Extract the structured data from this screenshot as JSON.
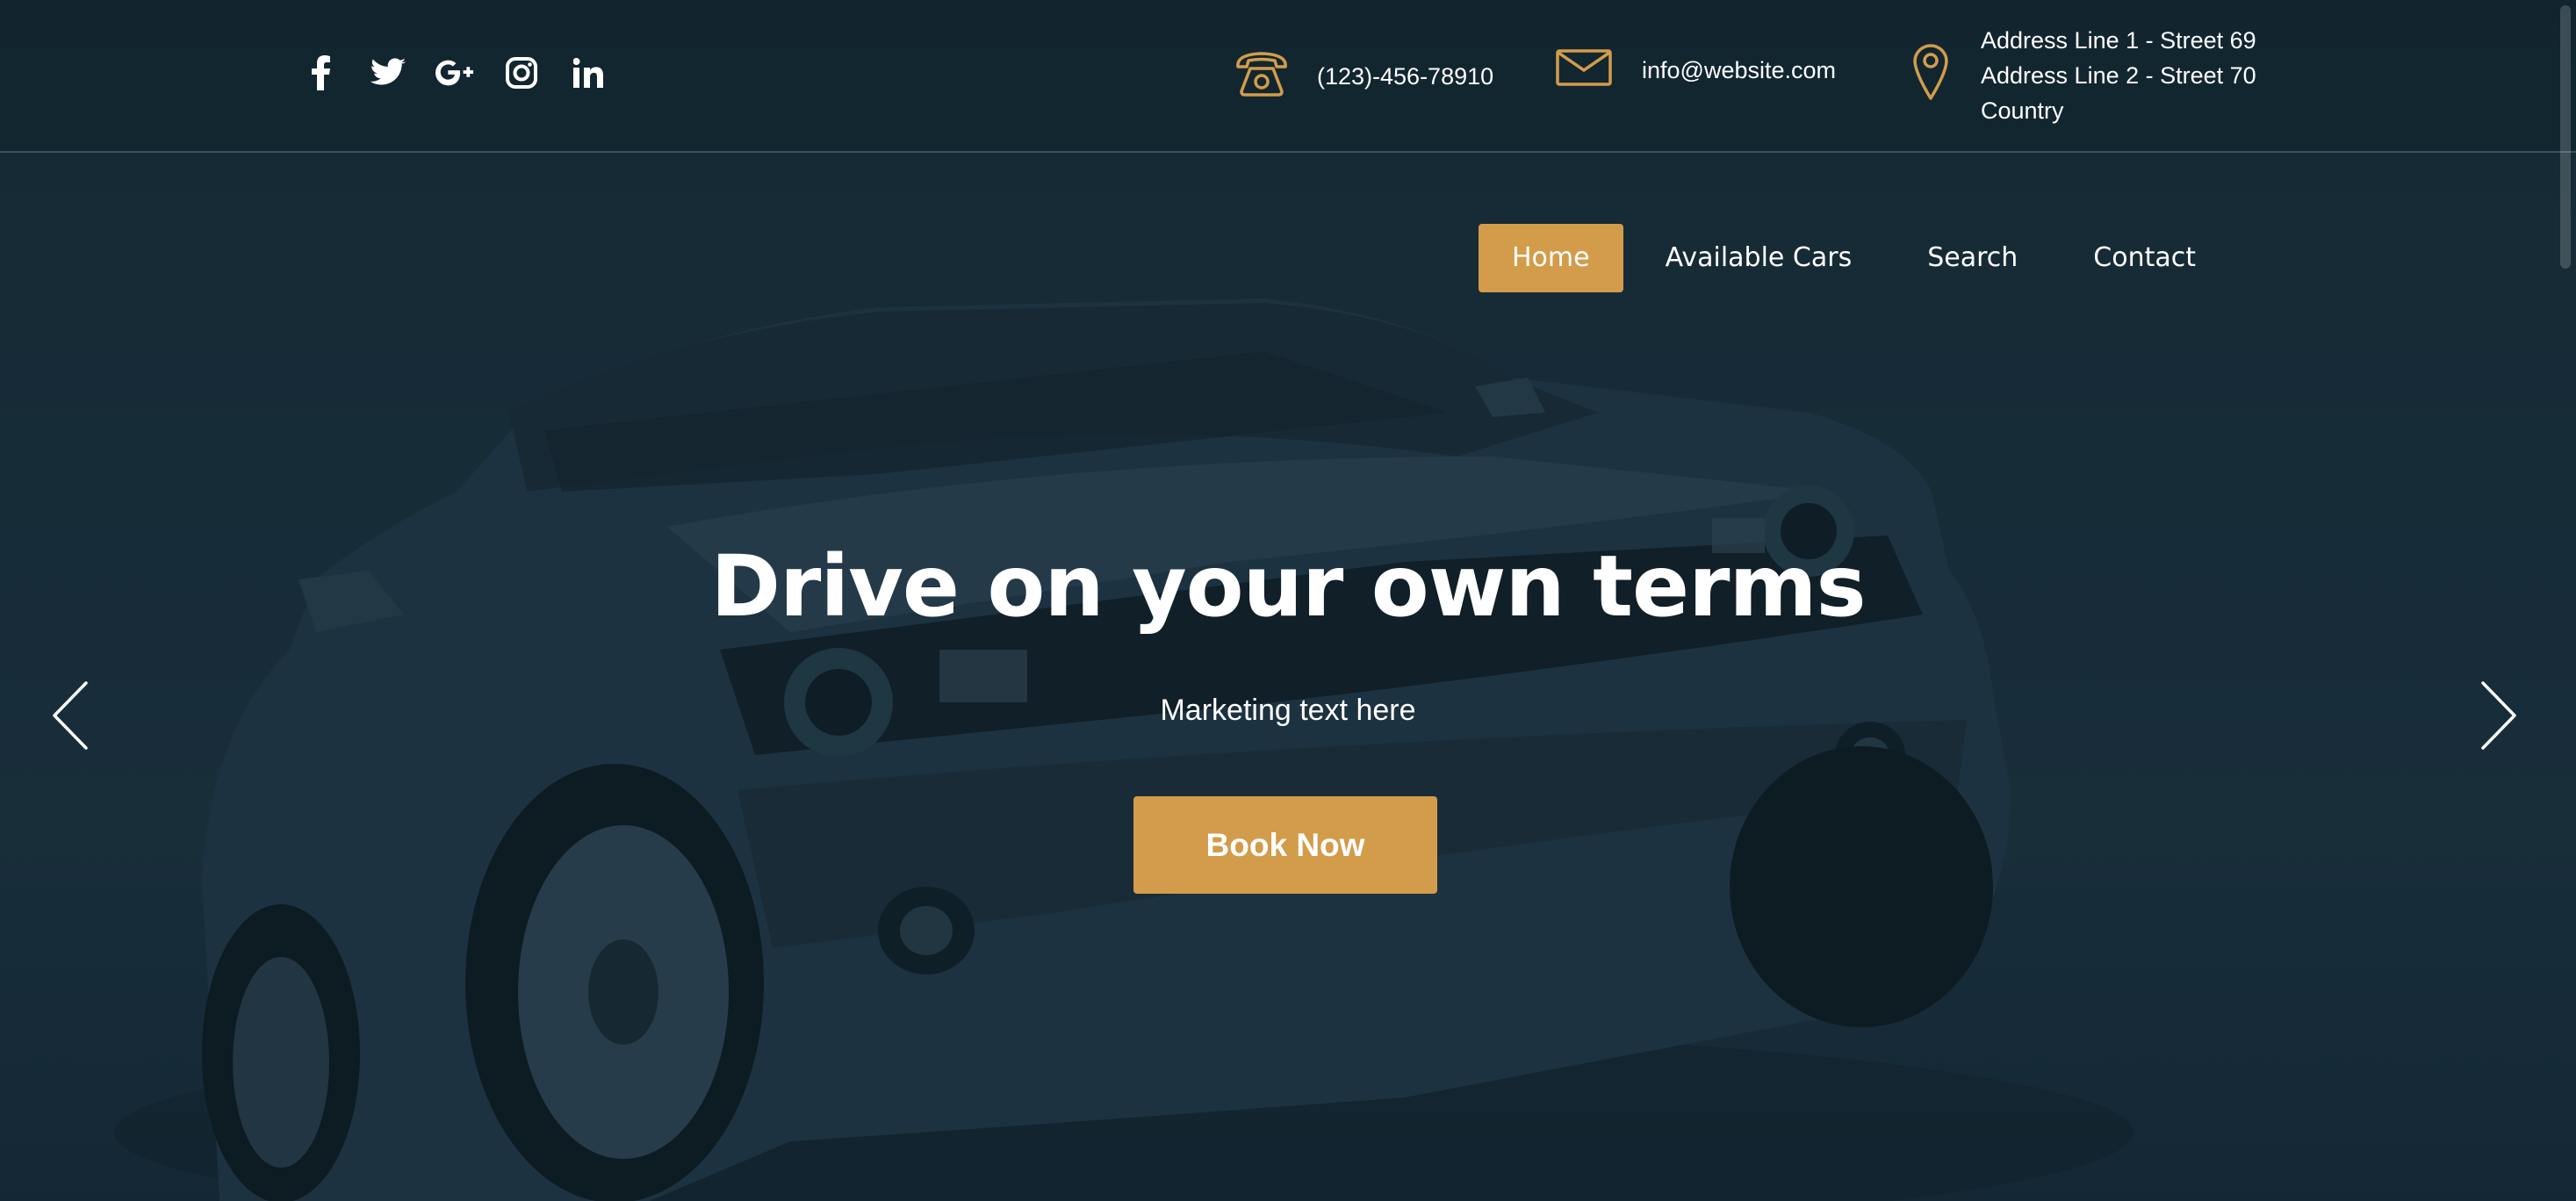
{
  "colors": {
    "accent": "#d39c4b",
    "background": "#132630",
    "text": "#ffffff"
  },
  "topbar": {
    "social": [
      {
        "name": "facebook-icon"
      },
      {
        "name": "twitter-icon"
      },
      {
        "name": "google-plus-icon"
      },
      {
        "name": "instagram-icon"
      },
      {
        "name": "linkedin-icon"
      }
    ],
    "phone": {
      "icon": "phone-icon",
      "text": "(123)-456-78910"
    },
    "email": {
      "icon": "envelope-icon",
      "text": "info@website.com"
    },
    "address": {
      "icon": "map-pin-icon",
      "lines": [
        "Address Line 1 - Street 69",
        "Address Line 2 - Street 70",
        "Country"
      ]
    }
  },
  "nav": {
    "items": [
      {
        "label": "Home",
        "active": true
      },
      {
        "label": "Available Cars",
        "active": false
      },
      {
        "label": "Search",
        "active": false
      },
      {
        "label": "Contact",
        "active": false
      }
    ]
  },
  "hero": {
    "title": "Drive on your own terms",
    "subtitle": "Marketing text here",
    "cta_label": "Book Now",
    "prev_icon": "chevron-left-icon",
    "next_icon": "chevron-right-icon"
  }
}
